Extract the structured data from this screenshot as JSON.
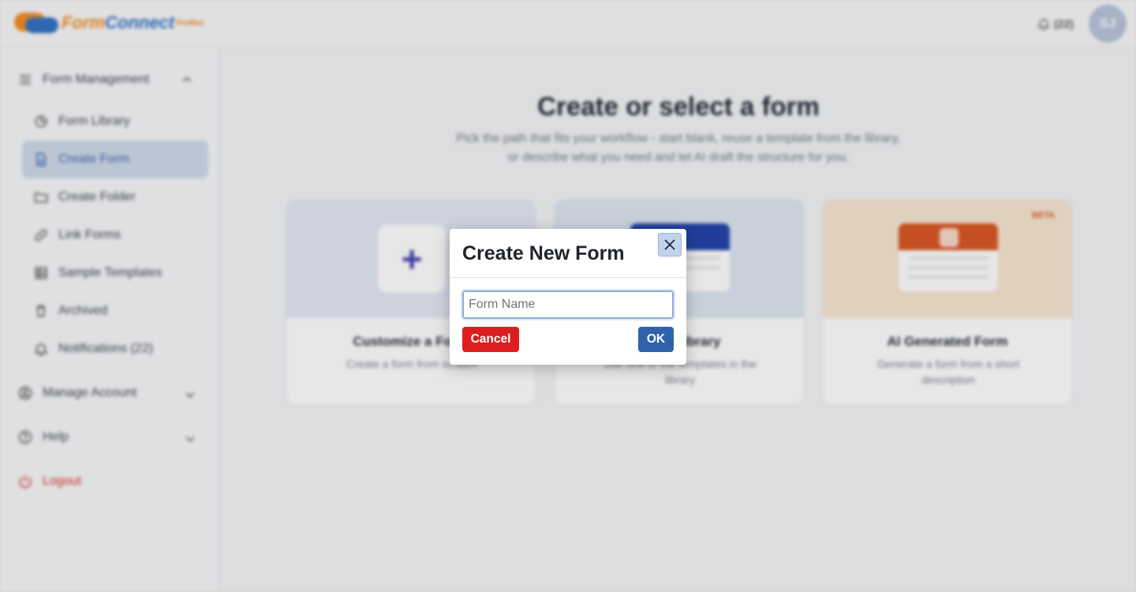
{
  "app": {
    "logo": {
      "text_part1": "Form",
      "text_part2": "Connect",
      "suffix": "ProMax"
    },
    "notifications": {
      "count_label": "(22)"
    },
    "avatar_initials": "SJ"
  },
  "sidebar": {
    "group_form_management": "Form Management",
    "items": [
      {
        "label": "Form Library"
      },
      {
        "label": "Create Form"
      },
      {
        "label": "Create Folder"
      },
      {
        "label": "Link Forms"
      },
      {
        "label": "Sample Templates"
      },
      {
        "label": "Archived"
      },
      {
        "label": "Notifications (22)"
      }
    ],
    "manage_account": "Manage Account",
    "help": "Help",
    "logout": "Logout"
  },
  "main": {
    "title": "Create or select a form",
    "subtitle": "Pick the path that fits your workflow - start blank, reuse a template from the library, or describe what you need and let AI draft the structure for you.",
    "cards": [
      {
        "title": "Customize a Form",
        "desc": "Create a form from scratch"
      },
      {
        "title": "Form Library",
        "desc": "Use one of the templates in the library"
      },
      {
        "title": "AI Generated Form",
        "desc": "Generate a form from a short description",
        "badge": "BETA"
      }
    ]
  },
  "modal": {
    "title": "Create New Form",
    "input_placeholder": "Form Name",
    "input_value": "",
    "cancel_label": "Cancel",
    "ok_label": "OK"
  },
  "colors": {
    "cancel": "#dc1e1e",
    "ok": "#2f62ab",
    "brand_orange": "#f28a1f",
    "brand_blue": "#2e6fc2",
    "logout": "#e02424"
  }
}
